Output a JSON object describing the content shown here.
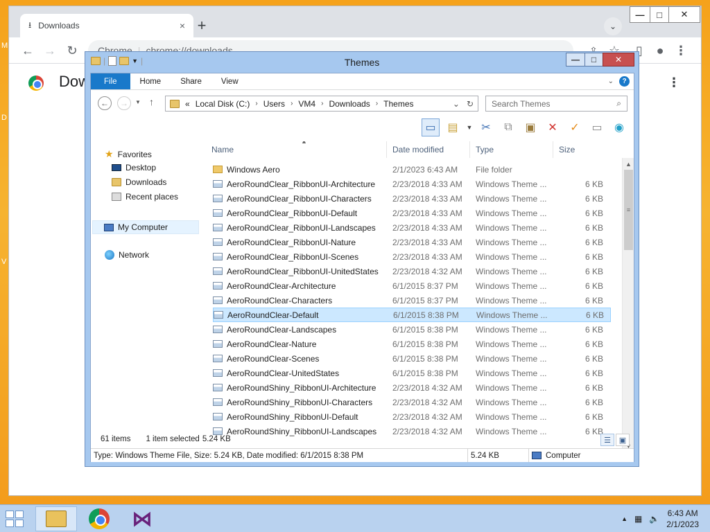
{
  "desktop": {
    "edge_letters": [
      "M",
      "D",
      "V"
    ]
  },
  "chrome": {
    "tab_title": "Downloads",
    "tab_close": "×",
    "new_tab": "+",
    "url_scheme": "Chrome",
    "url": "chrome://downloads",
    "page_title": "Dow",
    "kebab": "⋮",
    "win_min": "—",
    "win_max": "□",
    "win_close": "✕"
  },
  "explorer": {
    "title": "Themes",
    "win_min": "—",
    "win_max": "□",
    "win_close": "✕",
    "ribbon_tabs": [
      "File",
      "Home",
      "Share",
      "View"
    ],
    "help": "?",
    "breadcrumb": [
      "«",
      "Local Disk (C:)",
      "Users",
      "VM4",
      "Downloads",
      "Themes"
    ],
    "search_placeholder": "Search Themes",
    "nav": {
      "favorites": "Favorites",
      "desktop": "Desktop",
      "downloads": "Downloads",
      "recent": "Recent places",
      "computer": "My Computer",
      "network": "Network"
    },
    "columns": {
      "name": "Name",
      "date": "Date modified",
      "type": "Type",
      "size": "Size"
    },
    "files": [
      {
        "name": "Windows Aero",
        "date": "2/1/2023 6:43 AM",
        "type": "File folder",
        "size": "",
        "folder": true
      },
      {
        "name": "AeroRoundClear_RibbonUI-Architecture",
        "date": "2/23/2018 4:33 AM",
        "type": "Windows Theme ...",
        "size": "6 KB"
      },
      {
        "name": "AeroRoundClear_RibbonUI-Characters",
        "date": "2/23/2018 4:33 AM",
        "type": "Windows Theme ...",
        "size": "6 KB"
      },
      {
        "name": "AeroRoundClear_RibbonUI-Default",
        "date": "2/23/2018 4:33 AM",
        "type": "Windows Theme ...",
        "size": "6 KB"
      },
      {
        "name": "AeroRoundClear_RibbonUI-Landscapes",
        "date": "2/23/2018 4:33 AM",
        "type": "Windows Theme ...",
        "size": "6 KB"
      },
      {
        "name": "AeroRoundClear_RibbonUI-Nature",
        "date": "2/23/2018 4:33 AM",
        "type": "Windows Theme ...",
        "size": "6 KB"
      },
      {
        "name": "AeroRoundClear_RibbonUI-Scenes",
        "date": "2/23/2018 4:33 AM",
        "type": "Windows Theme ...",
        "size": "6 KB"
      },
      {
        "name": "AeroRoundClear_RibbonUI-UnitedStates",
        "date": "2/23/2018 4:32 AM",
        "type": "Windows Theme ...",
        "size": "6 KB"
      },
      {
        "name": "AeroRoundClear-Architecture",
        "date": "6/1/2015 8:37 PM",
        "type": "Windows Theme ...",
        "size": "6 KB"
      },
      {
        "name": "AeroRoundClear-Characters",
        "date": "6/1/2015 8:37 PM",
        "type": "Windows Theme ...",
        "size": "6 KB"
      },
      {
        "name": "AeroRoundClear-Default",
        "date": "6/1/2015 8:38 PM",
        "type": "Windows Theme ...",
        "size": "6 KB",
        "selected": true
      },
      {
        "name": "AeroRoundClear-Landscapes",
        "date": "6/1/2015 8:38 PM",
        "type": "Windows Theme ...",
        "size": "6 KB"
      },
      {
        "name": "AeroRoundClear-Nature",
        "date": "6/1/2015 8:38 PM",
        "type": "Windows Theme ...",
        "size": "6 KB"
      },
      {
        "name": "AeroRoundClear-Scenes",
        "date": "6/1/2015 8:38 PM",
        "type": "Windows Theme ...",
        "size": "6 KB"
      },
      {
        "name": "AeroRoundClear-UnitedStates",
        "date": "6/1/2015 8:38 PM",
        "type": "Windows Theme ...",
        "size": "6 KB"
      },
      {
        "name": "AeroRoundShiny_RibbonUI-Architecture",
        "date": "2/23/2018 4:32 AM",
        "type": "Windows Theme ...",
        "size": "6 KB"
      },
      {
        "name": "AeroRoundShiny_RibbonUI-Characters",
        "date": "2/23/2018 4:32 AM",
        "type": "Windows Theme ...",
        "size": "6 KB"
      },
      {
        "name": "AeroRoundShiny_RibbonUI-Default",
        "date": "2/23/2018 4:32 AM",
        "type": "Windows Theme ...",
        "size": "6 KB"
      },
      {
        "name": "AeroRoundShiny_RibbonUI-Landscapes",
        "date": "2/23/2018 4:32 AM",
        "type": "Windows Theme ...",
        "size": "6 KB"
      }
    ],
    "status": {
      "count": "61 items",
      "selected": "1 item selected",
      "sel_size": "5.24 KB"
    },
    "details": {
      "info": "Type: Windows Theme File, Size: 5.24 KB, Date modified: 6/1/2015 8:38 PM",
      "size": "5.24 KB",
      "location": "Computer"
    }
  },
  "taskbar": {
    "time": "6:43 AM",
    "date": "2/1/2023",
    "tray_up": "▲"
  },
  "colors": {
    "accent": "#1979ca",
    "selection": "#cce8ff",
    "taskbar": "#b9d2ef"
  }
}
